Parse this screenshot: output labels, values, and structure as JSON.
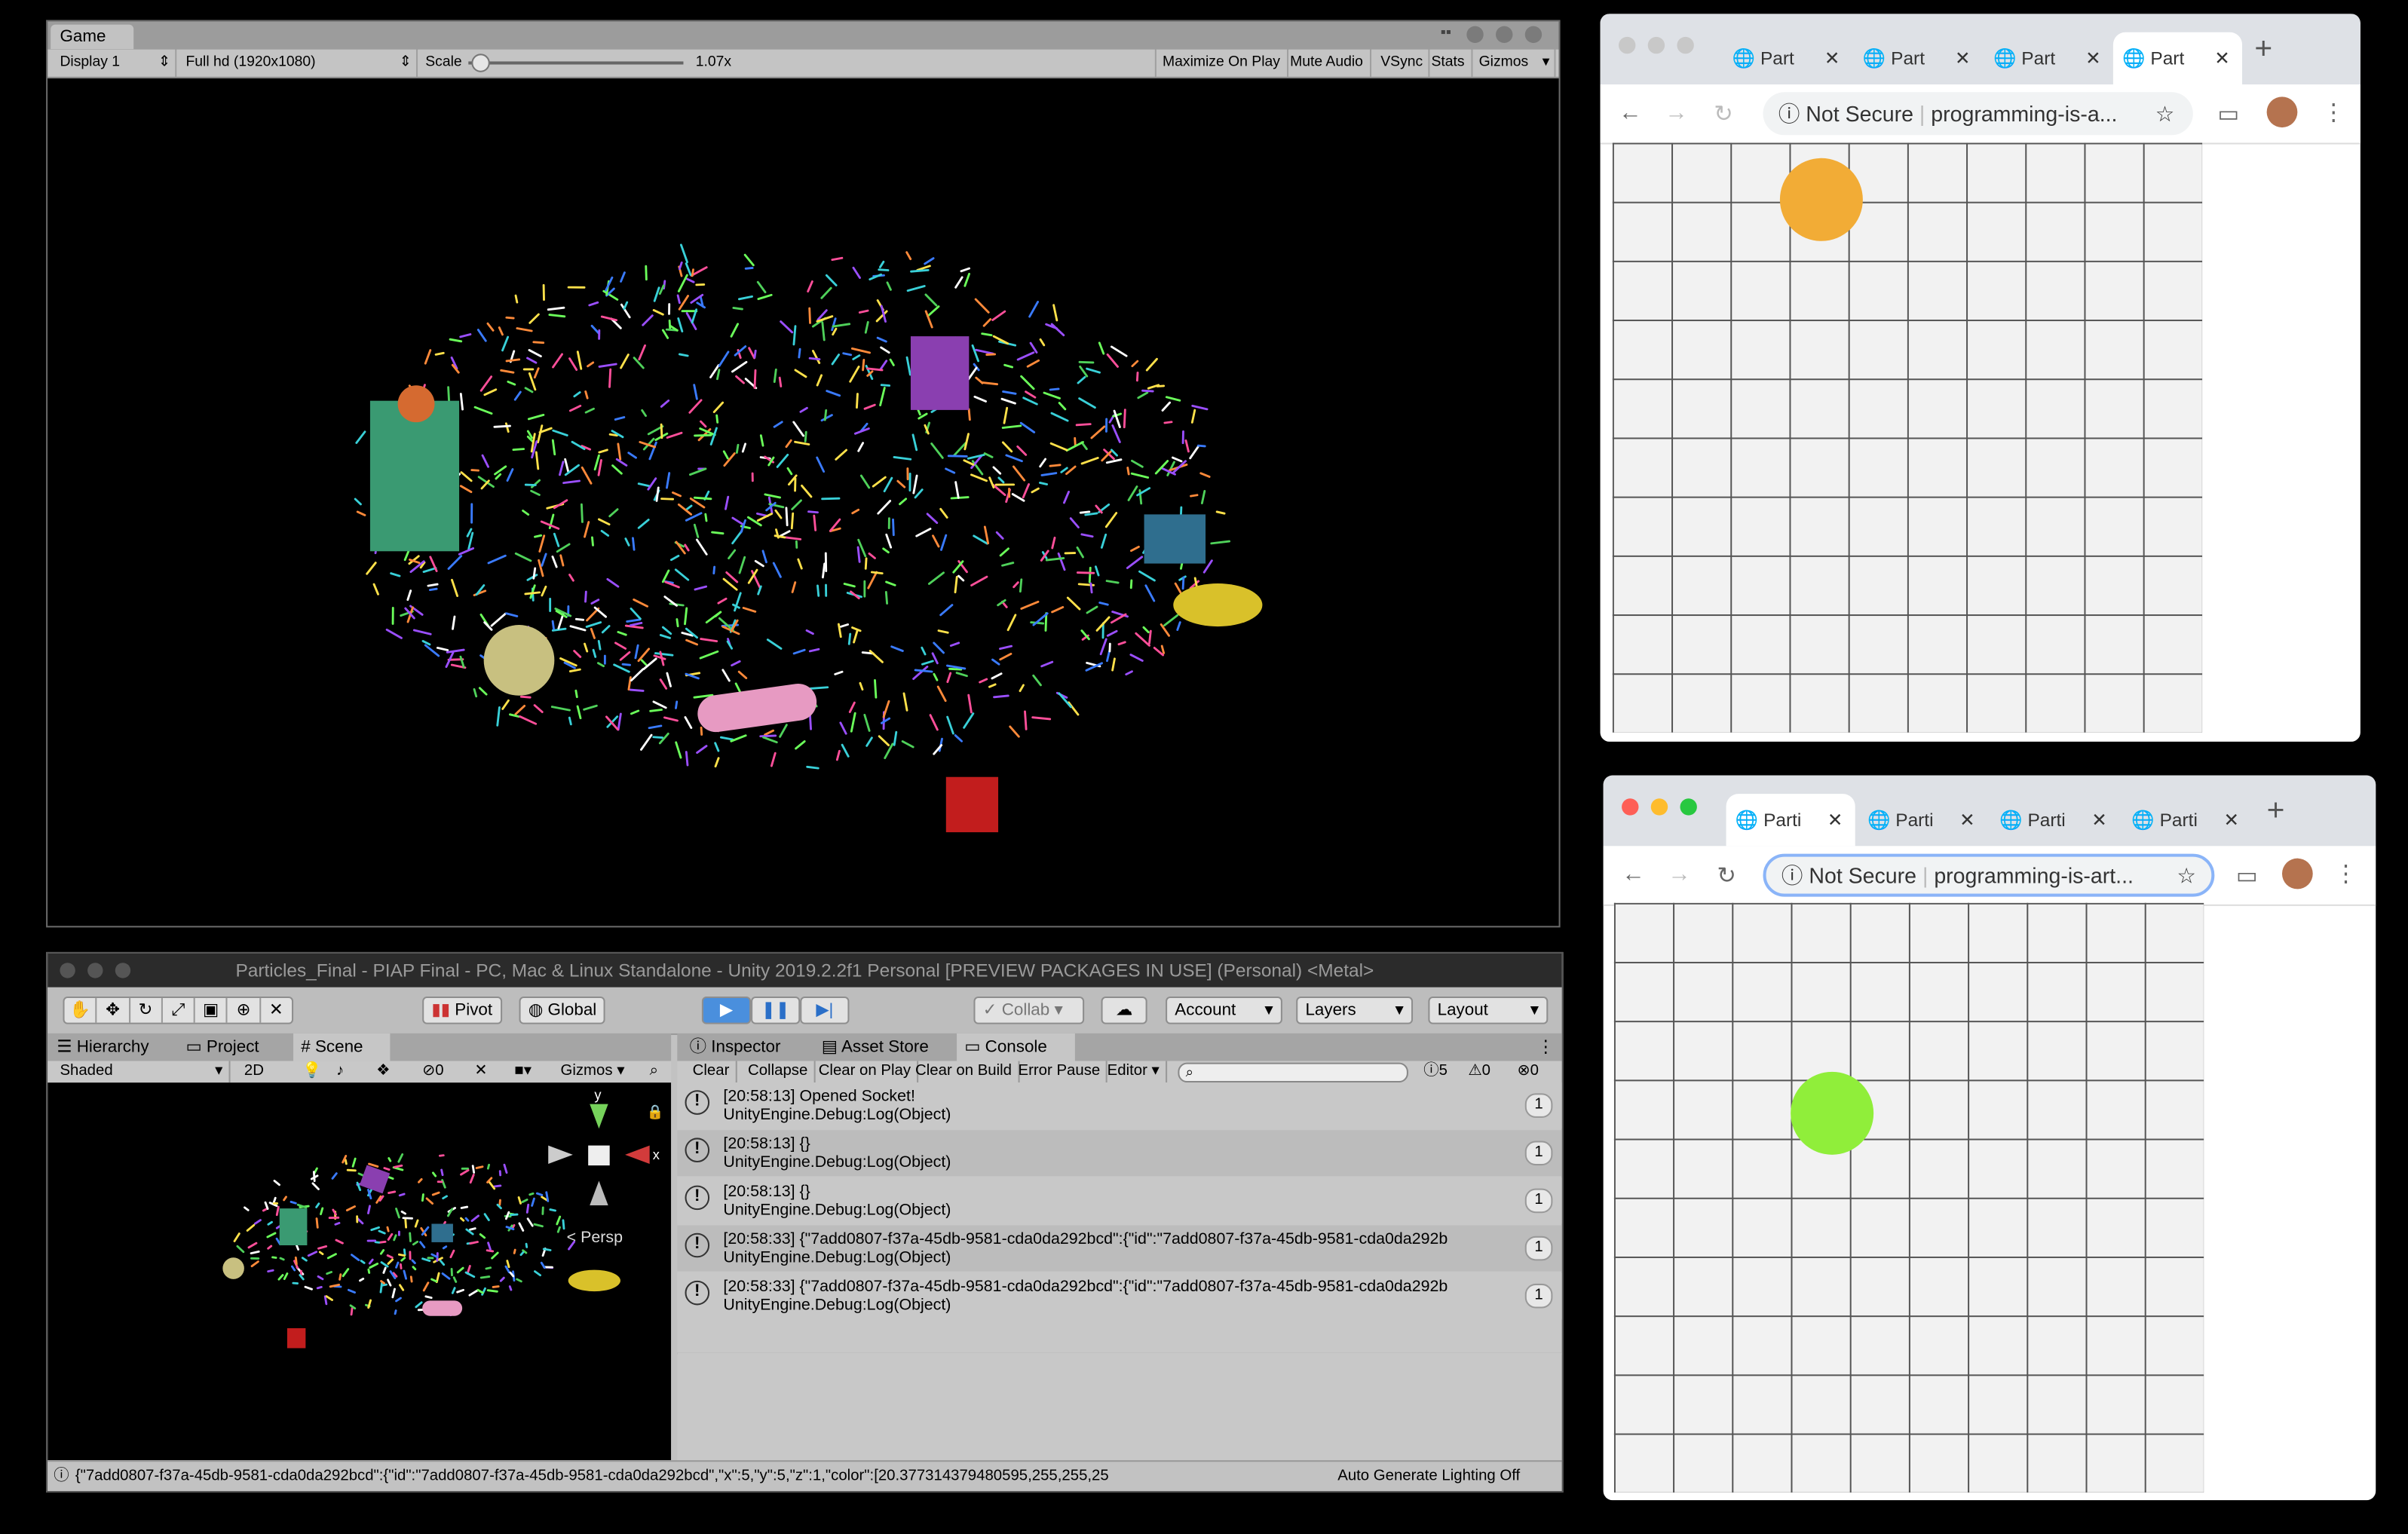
{
  "game": {
    "tab": "Game",
    "display": "Display 1",
    "resolution": "Full hd (1920x1080)",
    "scale_label": "Scale",
    "scale_value": "1.07x",
    "maximize": "Maximize On Play",
    "mute": "Mute Audio",
    "vsync": "VSync",
    "stats": "Stats",
    "gizmos": "Gizmos"
  },
  "editor": {
    "title": "Particles_Final - PIAP Final - PC, Mac & Linux Standalone - Unity 2019.2.2f1 Personal [PREVIEW PACKAGES IN USE] (Personal) <Metal>",
    "pivot": "Pivot",
    "global": "Global",
    "collab": "Collab",
    "account": "Account",
    "layers": "Layers",
    "layout": "Layout",
    "tabs_left": [
      "Hierarchy",
      "Project",
      "Scene"
    ],
    "tabs_right": [
      "Inspector",
      "Asset Store",
      "Console"
    ],
    "scene_toolbar": {
      "shaded": "Shaded",
      "mode2d": "2D",
      "hidden_count": "0",
      "gizmos": "Gizmos"
    },
    "persp": "< Persp",
    "console_toolbar": [
      "Clear",
      "Collapse",
      "Clear on Play",
      "Clear on Build",
      "Error Pause",
      "Editor"
    ],
    "counts": {
      "log": "5",
      "warn": "0",
      "error": "0"
    },
    "logs": [
      {
        "line1": "[20:58:13] Opened Socket!",
        "line2": "UnityEngine.Debug:Log(Object)",
        "count": "1"
      },
      {
        "line1": "[20:58:13] {}",
        "line2": "UnityEngine.Debug:Log(Object)",
        "count": "1"
      },
      {
        "line1": "[20:58:13] {}",
        "line2": "UnityEngine.Debug:Log(Object)",
        "count": "1"
      },
      {
        "line1": "[20:58:33] {\"7add0807-f37a-45db-9581-cda0da292bcd\":{\"id\":\"7add0807-f37a-45db-9581-cda0da292b",
        "line2": "UnityEngine.Debug:Log(Object)",
        "count": "1"
      },
      {
        "line1": "[20:58:33] {\"7add0807-f37a-45db-9581-cda0da292bcd\":{\"id\":\"7add0807-f37a-45db-9581-cda0da292b",
        "line2": "UnityEngine.Debug:Log(Object)",
        "count": "1"
      }
    ],
    "status": "{\"7add0807-f37a-45db-9581-cda0da292bcd\":{\"id\":\"7add0807-f37a-45db-9581-cda0da292bcd\",\"x\":5,\"y\":5,\"z\":1,\"color\":[20.377314379480595,255,255,25",
    "lighting": "Auto Generate Lighting Off"
  },
  "browser_top": {
    "tabs": [
      "Part",
      "Part",
      "Part",
      "Part"
    ],
    "security": "Not Secure",
    "url": "programming-is-a...",
    "circle_color": "#f2ac36"
  },
  "browser_bottom": {
    "tabs": [
      "Parti",
      "Parti",
      "Parti",
      "Parti"
    ],
    "security": "Not Secure",
    "url": "programming-is-art...",
    "circle_color": "#90ee3a"
  },
  "colors": {
    "unity_gray": "#c2c2c2",
    "play_active": "#4a8fdd"
  }
}
